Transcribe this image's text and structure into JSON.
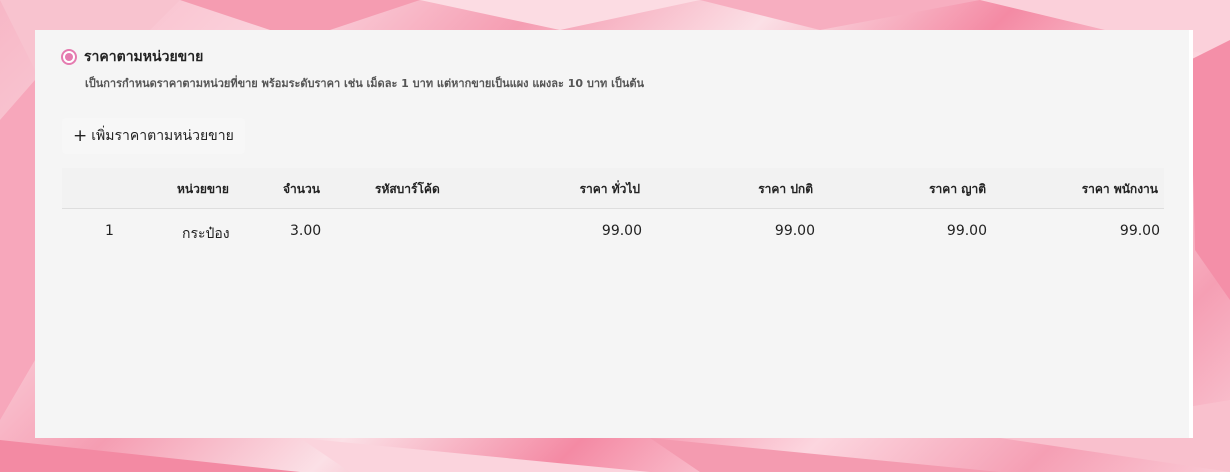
{
  "price_section": {
    "radio_label": "ราคาตามหน่วยขาย",
    "description": "เป็นการกำหนดราคาตามหน่วยที่ขาย พร้อมระดับราคา เช่น เม็ดละ 1 บาท แต่หากขายเป็นแผง แผงละ 10 บาท เป็นต้น",
    "add_button_label": "เพิ่มราคาตามหน่วยขาย",
    "selected": true,
    "accent_color": "#e57bb0"
  },
  "table": {
    "headers": {
      "unit": "หน่วยขาย",
      "quantity": "จำนวน",
      "barcode": "รหัสบาร์โค้ด",
      "price_general": "ราคา ทั่วไป",
      "price_normal": "ราคา ปกติ",
      "price_relative": "ราคา ญาติ",
      "price_staff": "ราคา พนักงาน"
    },
    "rows": [
      {
        "index": "1",
        "unit": "กระป๋อง",
        "quantity": "3.00",
        "barcode": "",
        "price_general": "99.00",
        "price_normal": "99.00",
        "price_relative": "99.00",
        "price_staff": "99.00"
      }
    ]
  }
}
